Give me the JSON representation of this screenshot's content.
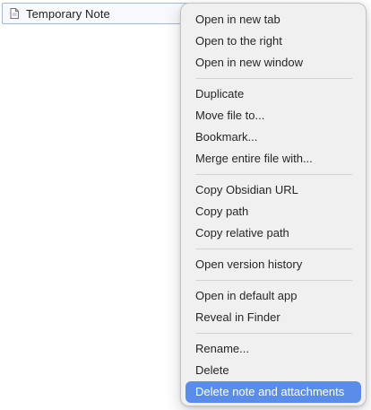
{
  "file_explorer": {
    "selected_file": {
      "name": "Temporary Note",
      "icon": "document-icon"
    }
  },
  "context_menu": {
    "groups": [
      [
        "Open in new tab",
        "Open to the right",
        "Open in new window"
      ],
      [
        "Duplicate",
        "Move file to...",
        "Bookmark...",
        "Merge entire file with..."
      ],
      [
        "Copy Obsidian URL",
        "Copy path",
        "Copy relative path"
      ],
      [
        "Open version history"
      ],
      [
        "Open in default app",
        "Reveal in Finder"
      ],
      [
        "Rename...",
        "Delete",
        "Delete note and attachments"
      ]
    ],
    "highlighted_item": "Delete note and attachments",
    "highlight_color": "#5a8de9"
  }
}
